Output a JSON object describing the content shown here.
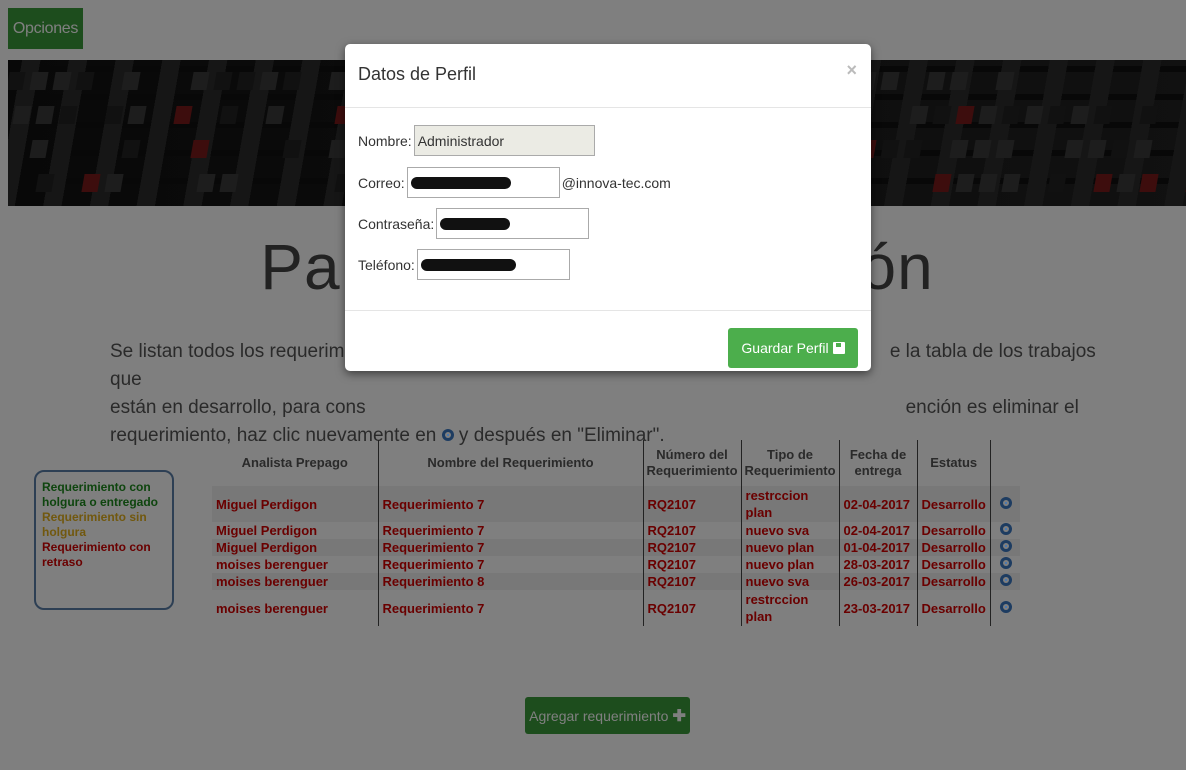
{
  "opciones_label": "Opciones",
  "title_partial": "Pa",
  "title_end": "ón",
  "intro": {
    "line1_a": "Se listan todos los requerimien",
    "line1_b": "e la tabla de los trabajos que",
    "line2_a": "están en desarrollo, para cons",
    "line2_b": "ención es eliminar el",
    "line3": "requerimiento, haz clic nuevamente en",
    "line3_b": "y después en \"Eliminar\"."
  },
  "legend": {
    "green": "Requerimiento con holgura o entregado",
    "yellow": "Requerimiento sin holgura",
    "red": "Requerimiento con retraso"
  },
  "table": {
    "headers": [
      "Analista Prepago",
      "Nombre del Requerimiento",
      "Número del Requerimiento",
      "Tipo de Requerimiento",
      "Fecha de entrega",
      "Estatus"
    ],
    "rows": [
      [
        "Miguel Perdigon",
        "Requerimiento 7",
        "RQ2107",
        "restrccion plan",
        "02-04-2017",
        "Desarrollo"
      ],
      [
        "Miguel Perdigon",
        "Requerimiento 7",
        "RQ2107",
        "nuevo sva",
        "02-04-2017",
        "Desarrollo"
      ],
      [
        "Miguel Perdigon",
        "Requerimiento 7",
        "RQ2107",
        "nuevo plan",
        "01-04-2017",
        "Desarrollo"
      ],
      [
        "moises berenguer",
        "Requerimiento 7",
        "RQ2107",
        "nuevo plan",
        "28-03-2017",
        "Desarrollo"
      ],
      [
        "moises berenguer",
        "Requerimiento 8",
        "RQ2107",
        "nuevo sva",
        "26-03-2017",
        "Desarrollo"
      ],
      [
        "moises berenguer",
        "Requerimiento 7",
        "RQ2107",
        "restrccion plan",
        "23-03-2017",
        "Desarrollo"
      ]
    ]
  },
  "add_button": "Agregar requerimiento",
  "modal": {
    "title": "Datos de Perfil",
    "close": "×",
    "nombre_label": "Nombre:",
    "nombre_value": "Administrador",
    "correo_label": "Correo:",
    "correo_suffix": "@innova-tec.com",
    "contrasena_label": "Contraseña:",
    "telefono_label": "Teléfono:",
    "save_label": "Guardar Perfil"
  },
  "colors": {
    "green_button": "#3a9a3a",
    "text_red": "#d40000",
    "text_green": "#1c8a1c",
    "text_yellow": "#e3b01d"
  }
}
